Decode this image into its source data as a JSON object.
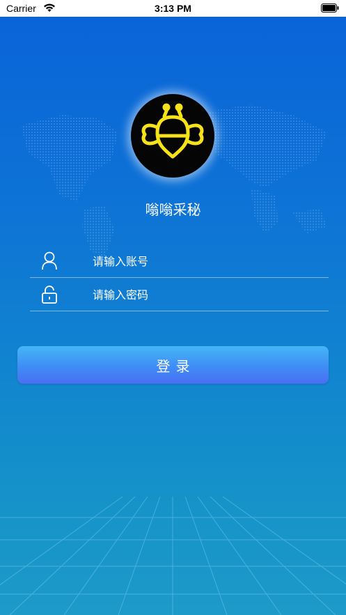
{
  "status_bar": {
    "carrier": "Carrier",
    "time": "3:13 PM"
  },
  "app": {
    "title": "嗡嗡采秘"
  },
  "login_form": {
    "account_placeholder": "请输入账号",
    "password_placeholder": "请输入密码",
    "login_label": "登录"
  },
  "icons": {
    "account": "user-icon",
    "password": "lock-icon",
    "logo": "bee-logo-icon"
  },
  "colors": {
    "background_top": "#0a63d8",
    "background_bottom": "#1d9ac8",
    "button_top": "#44b6f7",
    "button_bottom": "#4a6ef3",
    "logo_accent": "#f5e21a"
  }
}
